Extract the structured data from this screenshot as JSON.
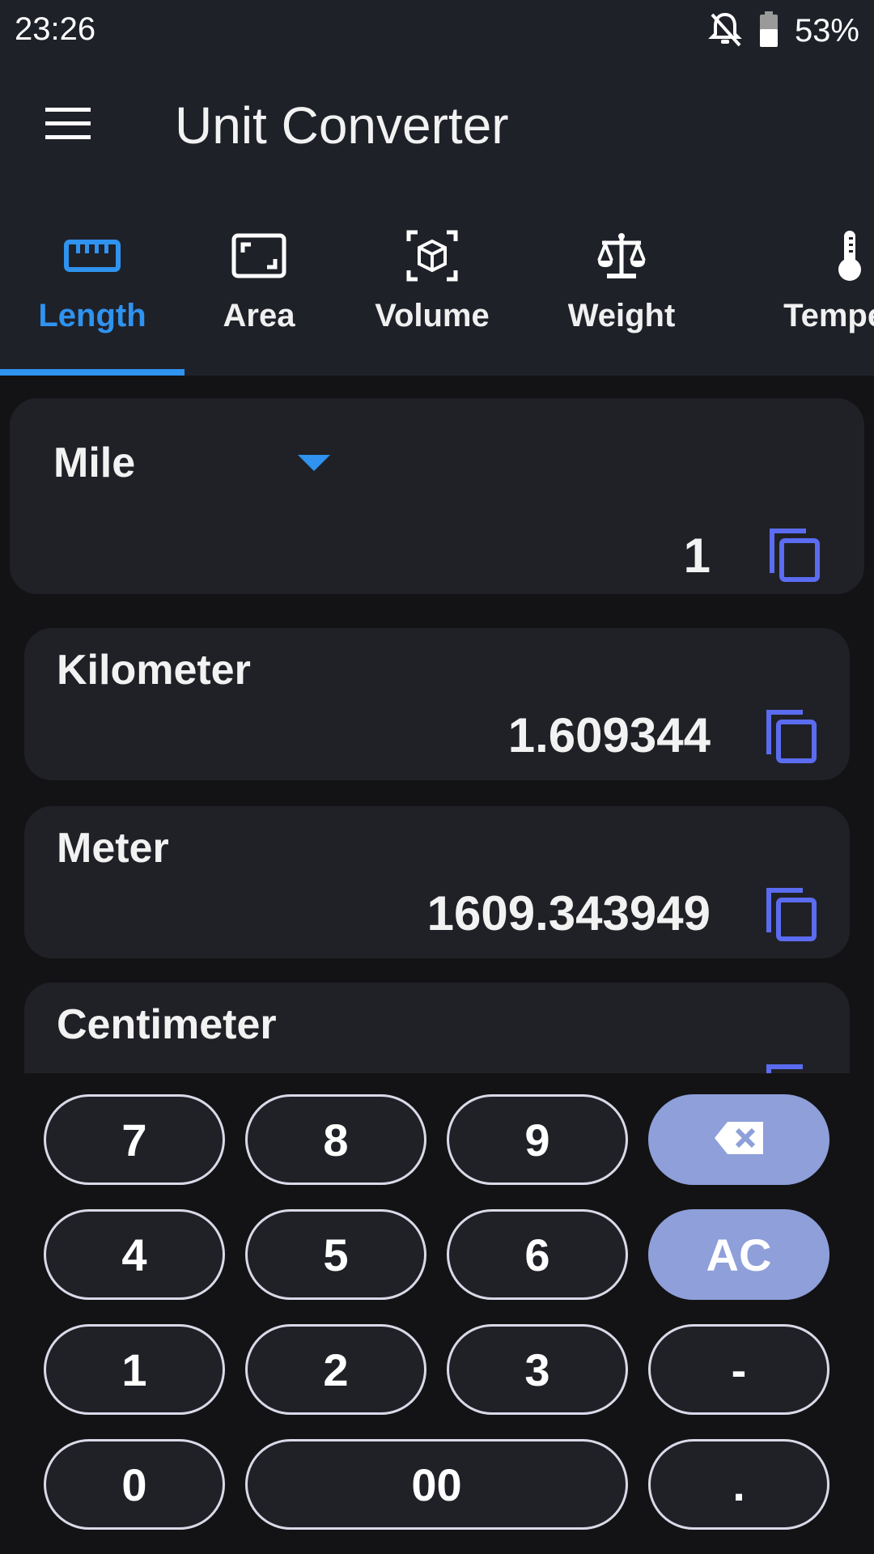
{
  "status": {
    "time": "23:26",
    "battery": "53%"
  },
  "app": {
    "title": "Unit Converter"
  },
  "tabs": [
    {
      "label": "Length",
      "icon": "ruler-icon",
      "active": true
    },
    {
      "label": "Area",
      "icon": "area-icon"
    },
    {
      "label": "Volume",
      "icon": "volume-cube-icon"
    },
    {
      "label": "Weight",
      "icon": "scale-icon"
    },
    {
      "label": "Tempera",
      "icon": "thermometer-icon"
    }
  ],
  "source": {
    "unit": "Mile",
    "value": "1"
  },
  "results": [
    {
      "unit": "Kilometer",
      "value": "1.609344"
    },
    {
      "unit": "Meter",
      "value": "1609.343949"
    },
    {
      "unit": "Centimeter",
      "value": ""
    }
  ],
  "keypad": {
    "k7": "7",
    "k8": "8",
    "k9": "9",
    "k4": "4",
    "k5": "5",
    "k6": "6",
    "ac": "AC",
    "k1": "1",
    "k2": "2",
    "k3": "3",
    "minus": "-",
    "k0": "0",
    "k00": "00",
    "dot": "."
  },
  "colors": {
    "accent": "#2f93ef",
    "copy_icon": "#5b6cf0",
    "action_key": "#8e9fda",
    "surface": "#202127",
    "bar": "#1f2129"
  }
}
